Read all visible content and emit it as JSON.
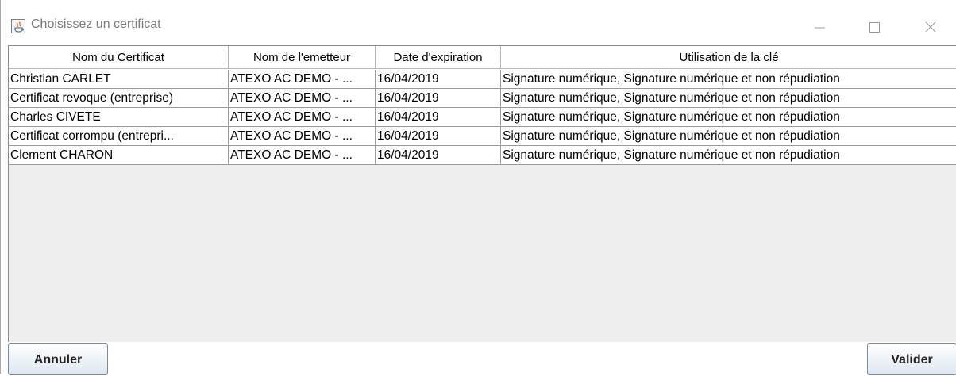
{
  "window": {
    "title": "Choisissez un certificat",
    "icon": "java-app-icon",
    "controls": [
      "minimize-icon",
      "maximize-icon",
      "close-icon"
    ]
  },
  "table": {
    "columns": [
      "Nom du Certificat",
      "Nom de l'emetteur",
      "Date d'expiration",
      "Utilisation de la clé"
    ],
    "rows": [
      [
        "Christian CARLET",
        "ATEXO AC DEMO - ...",
        "16/04/2019",
        "Signature numérique, Signature numérique et non répudiation"
      ],
      [
        "Certificat revoque (entreprise)",
        "ATEXO AC DEMO - ...",
        "16/04/2019",
        "Signature numérique, Signature numérique et non répudiation"
      ],
      [
        "Charles CIVETE",
        "ATEXO AC DEMO - ...",
        "16/04/2019",
        "Signature numérique, Signature numérique et non répudiation"
      ],
      [
        "Certificat corrompu (entrepri...",
        "ATEXO AC DEMO - ...",
        "16/04/2019",
        "Signature numérique, Signature numérique et non répudiation"
      ],
      [
        "Clement CHARON",
        "ATEXO AC DEMO - ...",
        "16/04/2019",
        "Signature numérique, Signature numérique et non répudiation"
      ]
    ]
  },
  "buttons": {
    "cancel": "Annuler",
    "ok": "Valider"
  }
}
